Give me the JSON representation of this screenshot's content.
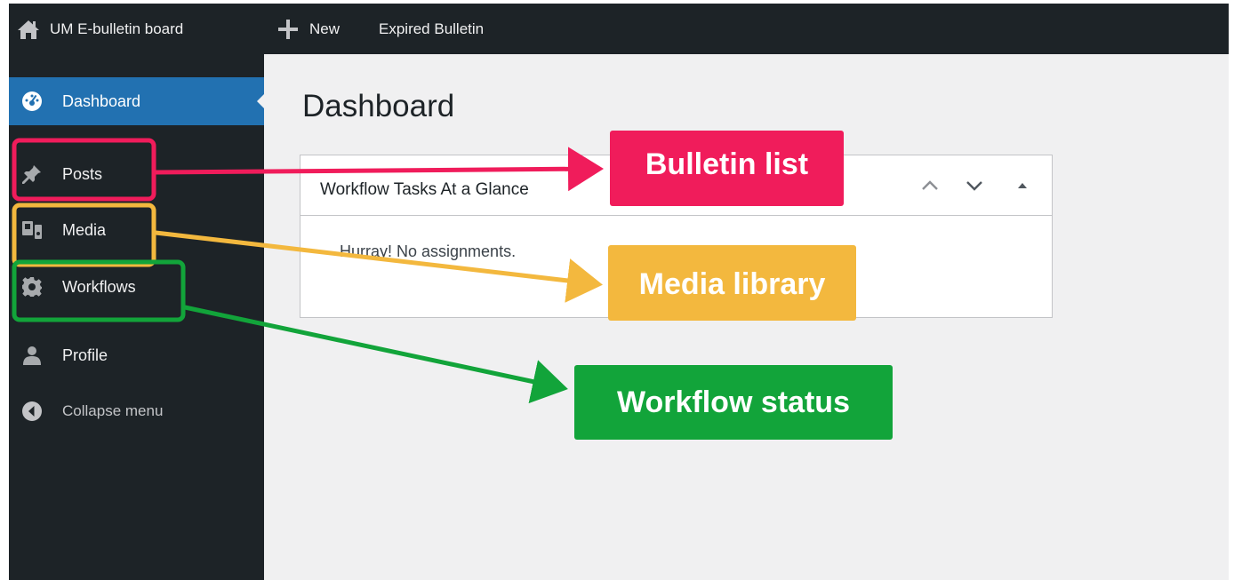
{
  "admin_bar": {
    "site_name": "UM E-bulletin board",
    "new_label": "New",
    "expired_label": "Expired Bulletin",
    "home_icon": "home-icon",
    "plus_icon": "plus-icon"
  },
  "sidebar": {
    "items": [
      {
        "label": "Dashboard",
        "icon": "dashboard-icon",
        "active": true
      },
      {
        "label": "Posts",
        "icon": "pin-icon"
      },
      {
        "label": "Media",
        "icon": "media-icon"
      },
      {
        "label": "Workflows",
        "icon": "gear-icon"
      },
      {
        "label": "Profile",
        "icon": "user-icon"
      },
      {
        "label": "Collapse menu",
        "icon": "collapse-icon"
      }
    ]
  },
  "main": {
    "title": "Dashboard",
    "widget": {
      "title": "Workflow Tasks At a Glance",
      "body": "Hurray! No assignments."
    }
  },
  "annotations": [
    {
      "label": "Bulletin list",
      "color": "#f01c5b"
    },
    {
      "label": "Media library",
      "color": "#f3b83e"
    },
    {
      "label": "Workflow status",
      "color": "#12a43a"
    }
  ],
  "colors": {
    "admin_bar_bg": "#1d2327",
    "active_menu_bg": "#2271b1",
    "content_bg": "#f0f0f1"
  }
}
